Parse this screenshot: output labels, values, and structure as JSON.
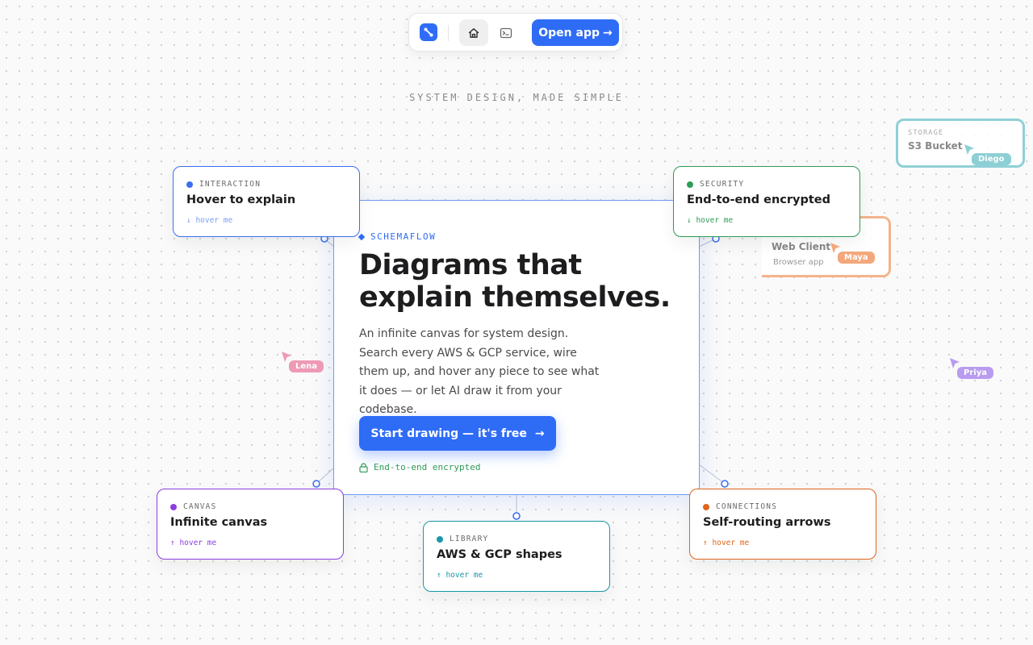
{
  "nav": {
    "open_app_label": "Open app",
    "open_app_arrow": "→"
  },
  "tagline": "SYSTEM DESIGN, MADE SIMPLE",
  "hero": {
    "eyebrow": "SCHEMAFLOW",
    "title_line1": "Diagrams that",
    "title_line2": "explain themselves.",
    "description": "An infinite canvas for system design. Search every AWS & GCP service, wire them up, and hover any piece to see what it does — or let AI draw it from your codebase.",
    "cta_label": "Start drawing — it's free",
    "cta_arrow": "→",
    "secure_text": "End-to-end encrypted"
  },
  "cards": {
    "interaction": {
      "category": "INTERACTION",
      "title": "Hover to explain",
      "hint": "↓ hover me",
      "color": "#3b6ff0"
    },
    "security": {
      "category": "SECURITY",
      "title": "End-to-end encrypted",
      "hint": "↓ hover me",
      "color": "#2e9b57"
    },
    "canvas": {
      "category": "CANVAS",
      "title": "Infinite canvas",
      "hint": "↑ hover me",
      "color": "#8b3fe0"
    },
    "library": {
      "category": "LIBRARY",
      "title": "AWS & GCP shapes",
      "hint": "↑ hover me",
      "color": "#1998a8"
    },
    "connections": {
      "category": "CONNECTIONS",
      "title": "Self-routing arrows",
      "hint": "↑ hover me",
      "color": "#e0651c"
    }
  },
  "ghost_cards": {
    "storage": {
      "category": "STORAGE",
      "title": "S3 Bucket",
      "color": "#8fd0d6"
    },
    "web_client": {
      "title": "Web Client",
      "subtitle": "Browser app",
      "color": "#f3b48c"
    }
  },
  "cursors": [
    {
      "name": "Diego",
      "color": "#8ccfd4"
    },
    {
      "name": "Maya",
      "color": "#f3a87c"
    },
    {
      "name": "Lena",
      "color": "#ee9ab5"
    },
    {
      "name": "Priya",
      "color": "#b89cf0"
    }
  ]
}
